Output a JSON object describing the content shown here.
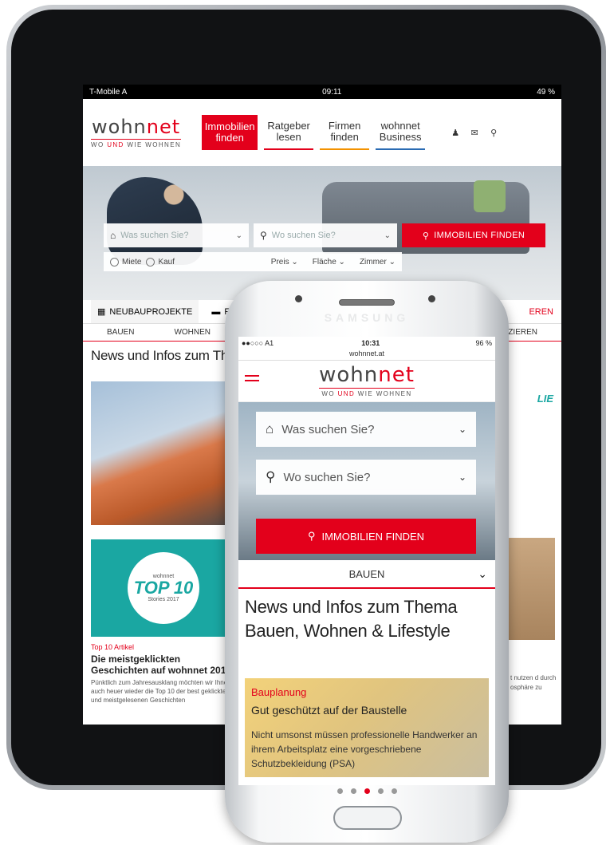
{
  "tablet": {
    "status": {
      "carrier": "T-Mobile A",
      "time": "09:11",
      "battery": "49 %"
    },
    "logo": {
      "word_a": "wohn",
      "word_b": "net",
      "tag_a": "WO ",
      "tag_und": "UND",
      "tag_b": " WIE WOHNEN"
    },
    "nav": [
      {
        "label": "Immobilien finden"
      },
      {
        "label": "Ratgeber lesen"
      },
      {
        "label": "Firmen finden"
      },
      {
        "label": "wohnnet Business"
      }
    ],
    "icons": [
      "user-icon",
      "mail-icon",
      "search-icon"
    ],
    "search": {
      "what_placeholder": "Was suchen Sie?",
      "where_placeholder": "Wo suchen Sie?",
      "button": "IMMOBILIEN FINDEN",
      "radio_rent": "Miete",
      "radio_buy": "Kauf",
      "filters": [
        "Preis",
        "Fläche",
        "Zimmer"
      ]
    },
    "tabs": {
      "tab1": "NEUBAUPROJEKTE",
      "tab2": "FE",
      "tab3": "EREN"
    },
    "subtabs": {
      "a": "BAUEN",
      "b": "WOHNEN",
      "c": "NZIEREN"
    },
    "news_title": "News und Infos zum Thema",
    "top10": {
      "small": "wohnnet",
      "big": "TOP 10",
      "stories": "Stories 2017"
    },
    "article": {
      "category": "Top 10 Artikel",
      "title": "Die meistgeklickten Geschichten auf wohnnet 2017",
      "text": "Pünktlich zum Jahresausklang möchten wir Ihnen auch heuer wieder die Top 10 der best geklickten und meistgelesenen Geschichten"
    },
    "right_badge": "LIE",
    "right_text": "t nutzen d durch osphäre zu"
  },
  "phone": {
    "brand": "SAMSUNG",
    "status": {
      "carrier": "●●○○○ A1",
      "time": "10:31",
      "battery": "96 %"
    },
    "url": "wohnnet.at",
    "search": {
      "what_placeholder": "Was suchen Sie?",
      "where_placeholder": "Wo suchen Sie?",
      "button": "IMMOBILIEN FINDEN"
    },
    "category": "BAUEN",
    "title": "News und Infos zum Thema Bauen, Wohnen & Lifestyle",
    "card": {
      "category": "Bauplanung",
      "title": "Gut geschützt auf der Baustelle",
      "text": "Nicht umsonst müssen professionelle Handwerker an ihrem Arbeitsplatz eine vorgeschriebene Schutzbekleidung (PSA)"
    },
    "carousel": {
      "count": 5,
      "active": 3
    }
  },
  "colors": {
    "brand_red": "#e3001b",
    "nav_orange": "#f39200",
    "nav_blue": "#2a6bb3",
    "top10_teal": "#1aa7a2"
  }
}
